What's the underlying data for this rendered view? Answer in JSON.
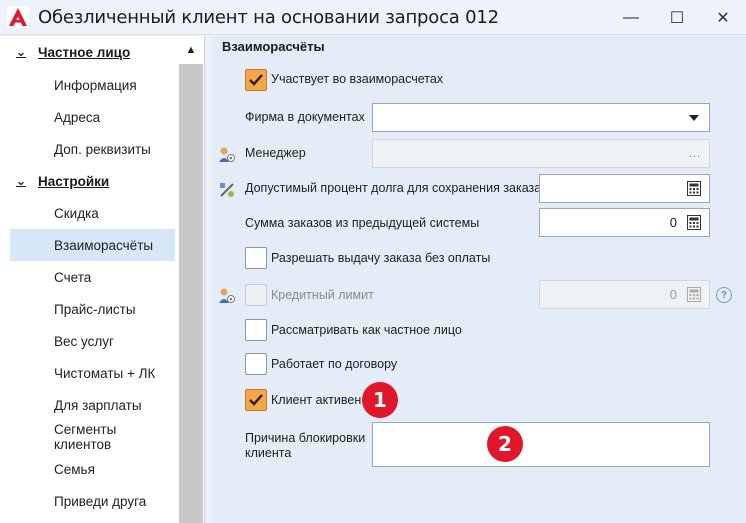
{
  "window": {
    "title": "Обезличенный клиент на основании запроса 012",
    "minimize_glyph": "—",
    "maximize_glyph": "☐",
    "close_glyph": "✕"
  },
  "nav": {
    "groups": [
      {
        "label": "Частное лицо",
        "items": [
          "Информация",
          "Адреса",
          "Доп. реквизиты"
        ]
      },
      {
        "label": "Настройки",
        "items": [
          "Скидка",
          "Взаиморасчёты",
          "Счета",
          "Прайс-листы",
          "Вес услуг",
          "Чистоматы + ЛК",
          "Для зарплаты",
          "Сегменты клиентов",
          "Семья",
          "Приведи друга"
        ]
      }
    ],
    "active_item": "Взаиморасчёты"
  },
  "form": {
    "section_title": "Взаиморасчёты",
    "participates": {
      "label": "Участвует во взаиморасчетах",
      "checked": true
    },
    "firm": {
      "label": "Фирма в документах",
      "value": ""
    },
    "manager": {
      "label": "Менеджер",
      "value": "",
      "button": "..."
    },
    "debt_percent": {
      "label": "Допустимый процент долга для сохранения заказа",
      "value": ""
    },
    "prev_orders_sum": {
      "label": "Сумма заказов из предыдущей системы",
      "value": "0"
    },
    "allow_without_payment": {
      "label": "Разрешать выдачу заказа без оплаты",
      "checked": false
    },
    "credit_limit": {
      "label": "Кредитный лимит",
      "value": "0",
      "checked": false,
      "disabled": true,
      "help": "?"
    },
    "as_private": {
      "label": "Рассматривать как частное лицо",
      "checked": false
    },
    "by_contract": {
      "label": "Работает по договору",
      "checked": false
    },
    "client_active": {
      "label": "Клиент активен",
      "checked": true
    },
    "block_reason": {
      "label_line1": "Причина блокировки",
      "label_line2": "клиента",
      "value": ""
    }
  },
  "annotations": {
    "badge1": "1",
    "badge2": "2"
  },
  "colors": {
    "accent_check": "#f6a64a",
    "badge": "#e0162b",
    "nav_active": "#d6e7f7"
  }
}
